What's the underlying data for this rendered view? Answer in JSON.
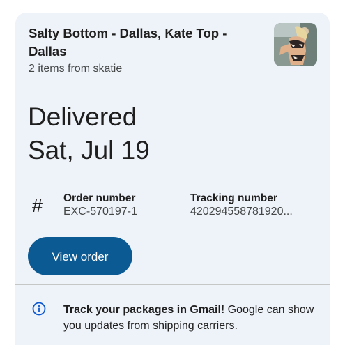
{
  "order": {
    "title": "Salty Bottom - Dallas, Kate Top - Dallas",
    "subtitle": "2 items from skatie",
    "thumbnail_icon": "product-photo",
    "status": "Delivered",
    "date": "Sat, Jul 19",
    "number_icon": "#",
    "order_number_label": "Order number",
    "order_number_value": "EXC-570197-1",
    "tracking_number_label": "Tracking number",
    "tracking_number_value": "420294558781920...",
    "view_order_label": "View order"
  },
  "info": {
    "icon": "info-icon",
    "bold_text": "Track your packages in Gmail!",
    "text": " Google can show you updates from shipping carriers."
  },
  "colors": {
    "card_bg": "#eef2f9",
    "button_bg": "#0b5a93",
    "info_icon": "#0b57d0"
  }
}
